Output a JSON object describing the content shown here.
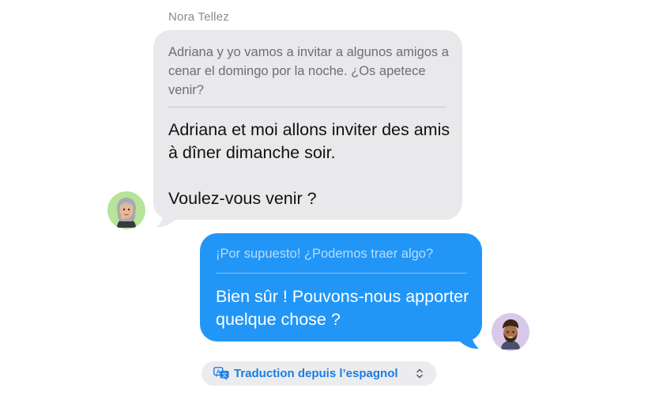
{
  "conversation": {
    "incoming": {
      "sender": "Nora Tellez",
      "original_text": "Adriana y yo vamos a invitar a algunos amigos a cenar el domingo por la noche. ¿Os apetece venir?",
      "translated_text_line1": "Adriana et moi allons inviter des amis à dîner dimanche soir.",
      "translated_text_line2": "Voulez-vous venir ?",
      "avatar": "memoji-woman-gray-hair",
      "bubble_color": "#e9e9eb"
    },
    "outgoing": {
      "original_text": "¡Por supuesto! ¿Podemos traer algo?",
      "translated_text": "Bien sûr ! Pouvons-nous apporter quelque chose ?",
      "avatar": "memoji-man-beard",
      "bubble_color": "#2196f7"
    }
  },
  "translation_control": {
    "label": "Traduction depuis l’espagnol",
    "icon": "translate-icon",
    "chevron": "chevron-up-down-icon",
    "accent_color": "#1a7de3"
  }
}
